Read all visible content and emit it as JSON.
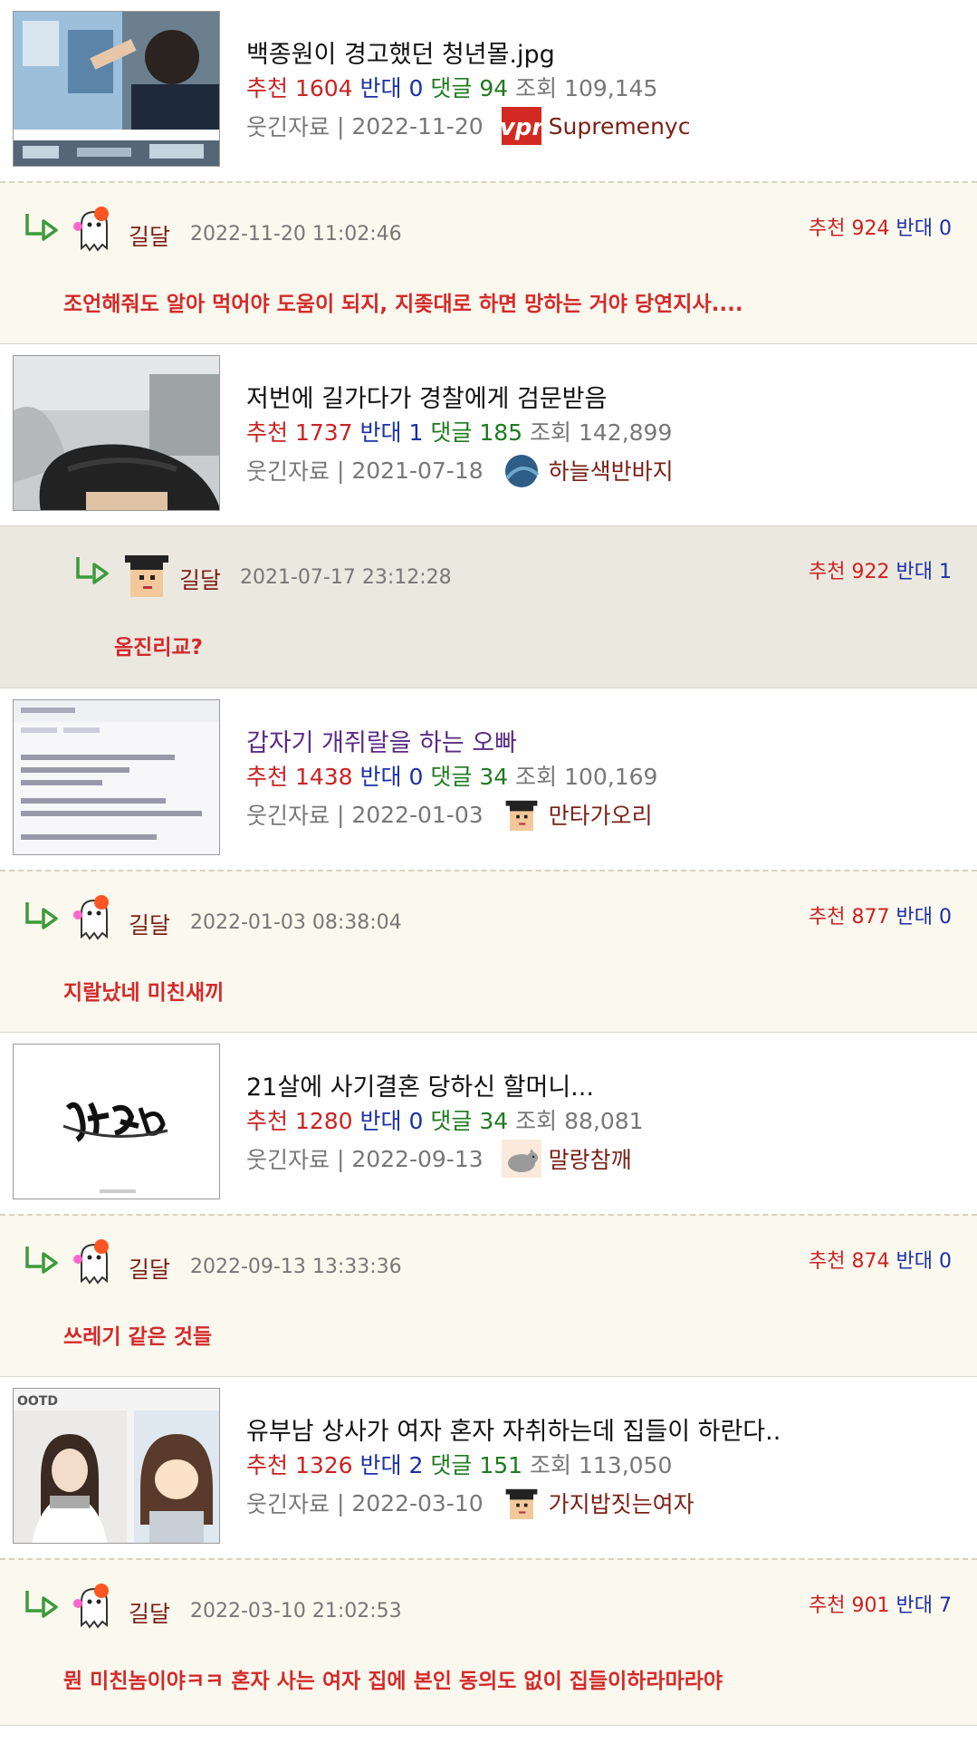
{
  "labels": {
    "recommend": "추천",
    "oppose": "반대",
    "comments": "댓글",
    "views": "조회"
  },
  "posts": [
    {
      "title": "백종원이 경고했던 청년몰.jpg",
      "recommend": "1604",
      "oppose": "0",
      "comments": "94",
      "views": "109,145",
      "category": "웃긴자료",
      "date": "2022-11-20",
      "author": "Supremenyc",
      "author_icon": "supreme-logo-icon",
      "thumb_icon": "photo-man-pointing-at-screen",
      "visited": false,
      "comment": {
        "author": "길달",
        "author_icon": "ghost-avatar-icon",
        "datetime": "2022-11-20 11:02:46",
        "recommend": "924",
        "oppose": "0",
        "text": "조언해줘도 알아 먹어야 도움이 되지, 지좆대로 하면 망하는 거야 당연지사....",
        "depth": 1
      }
    },
    {
      "title": "저번에 길가다가 경찰에게 검문받음",
      "recommend": "1737",
      "oppose": "1",
      "comments": "185",
      "views": "142,899",
      "category": "웃긴자료",
      "date": "2021-07-18",
      "author": "하늘색반바지",
      "author_icon": "blue-shorts-avatar-icon",
      "thumb_icon": "photo-top-of-head",
      "visited": false,
      "comment": {
        "author": "길달",
        "author_icon": "graduate-avatar-icon",
        "datetime": "2021-07-17 23:12:28",
        "recommend": "922",
        "oppose": "1",
        "text": "옴진리교?",
        "depth": 2
      }
    },
    {
      "title": "갑자기 개쥐랄을 하는 오빠",
      "recommend": "1438",
      "oppose": "0",
      "comments": "34",
      "views": "100,169",
      "category": "웃긴자료",
      "date": "2022-01-03",
      "author": "만타가오리",
      "author_icon": "graduate-avatar-icon",
      "thumb_icon": "chat-screenshot",
      "visited": true,
      "comment": {
        "author": "길달",
        "author_icon": "ghost-avatar-icon",
        "datetime": "2022-01-03 08:38:04",
        "recommend": "877",
        "oppose": "0",
        "text": "지랄났네 미친새끼",
        "depth": 1
      }
    },
    {
      "title": "21살에 사기결혼 당하신 할머니...",
      "recommend": "1280",
      "oppose": "0",
      "comments": "34",
      "views": "88,081",
      "category": "웃긴자료",
      "date": "2022-09-13",
      "author": "말랑참깨",
      "author_icon": "cat-avatar-icon",
      "thumb_icon": "calligraphy-image",
      "visited": false,
      "comment": {
        "author": "길달",
        "author_icon": "ghost-avatar-icon",
        "datetime": "2022-09-13 13:33:36",
        "recommend": "874",
        "oppose": "0",
        "text": "쓰레기 같은 것들",
        "depth": 1
      }
    },
    {
      "title": "유부남 상사가 여자 혼자 자취하는데 집들이 하란다..",
      "recommend": "1326",
      "oppose": "2",
      "comments": "151",
      "views": "113,050",
      "category": "웃긴자료",
      "date": "2022-03-10",
      "author": "가지밥짓는여자",
      "author_icon": "graduate-avatar-icon",
      "thumb_icon": "photo-ootd-girl-cartoon",
      "thumb_text": "OOTD",
      "visited": false,
      "comment": {
        "author": "길달",
        "author_icon": "ghost-avatar-icon",
        "datetime": "2022-03-10 21:02:53",
        "recommend": "901",
        "oppose": "7",
        "text": "뭔 미친놈이야ㅋㅋ 혼자 사는 여자 집에 본인 동의도 없이 집들이하라마라야",
        "depth": 1
      }
    }
  ]
}
